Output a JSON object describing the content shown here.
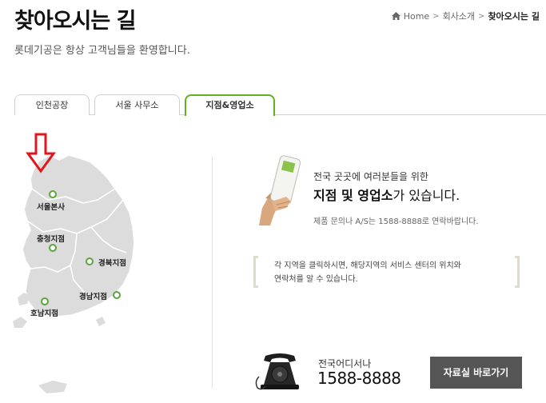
{
  "header": {
    "title": "찾아오시는 길",
    "subtitle": "롯데기공은 항상 고객님들을 환영합니다."
  },
  "breadcrumb": {
    "home": "Home",
    "parent": "회사소개",
    "current": "찾아오시는 길"
  },
  "tabs": [
    {
      "label": "인천공장",
      "active": false
    },
    {
      "label": "서울 사무소",
      "active": false
    },
    {
      "label": "지점&영업소",
      "active": true
    }
  ],
  "map": {
    "regions": [
      {
        "label": "서울본사",
        "icon": "circle-marker-icon"
      },
      {
        "label": "충청지점",
        "icon": "circle-marker-icon"
      },
      {
        "label": "경북지점",
        "icon": "circle-marker-icon"
      },
      {
        "label": "경남지점",
        "icon": "circle-marker-icon"
      },
      {
        "label": "호남지점",
        "icon": "circle-marker-icon"
      }
    ],
    "pointer_icon": "red-down-arrow-icon",
    "marker_color": "#5aa53d",
    "arrow_color": "#e0161c"
  },
  "intro": {
    "line1": "전국 곳곳에 여러분들을 위한",
    "line2_bold": "지점 및 영업소",
    "line2_rest": "가 있습니다.",
    "line3": "제품 문의나 A/S는 1588-8888로 연락바랍니다."
  },
  "note": {
    "line1": "각 지역을 클릭하시면, 해당지역의 서비스 센터의 위치와",
    "line2": "연락처를 알 수 있습니다."
  },
  "contact": {
    "label": "전국어디서나",
    "number": "1588-8888",
    "icon": "telephone-icon"
  },
  "archive_button": {
    "label": "자료실 바로가기"
  },
  "colors": {
    "accent_green": "#63b024",
    "button_bg": "#555555",
    "map_fill": "#dcdcdc"
  }
}
